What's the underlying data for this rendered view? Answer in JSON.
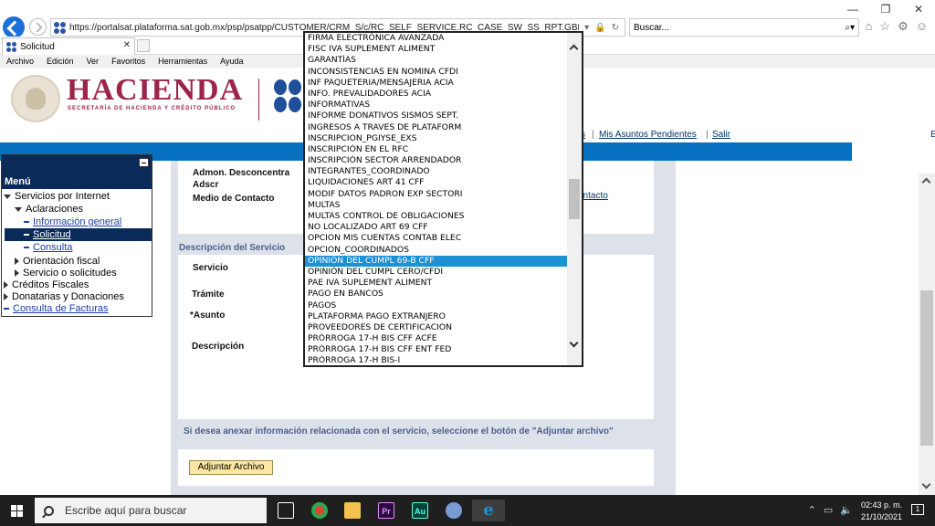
{
  "browser": {
    "url": "https://portalsat.plataforma.sat.gob.mx/psp/psatpp/CUSTOMER/CRM_S/c/RC_SELF_SERVICE.RC_CASE_SW_SS_RPT.GBL?DISP_TMPL_ID=RC_SUPI",
    "search_placeholder": "Buscar...",
    "tab_title": "Solicitud",
    "menu": [
      "Archivo",
      "Edición",
      "Ver",
      "Favoritos",
      "Herramientas",
      "Ayuda"
    ]
  },
  "header": {
    "brand": "HACIENDA",
    "brand_subtitle": "SECRETARÍA DE HACIENDA Y CRÉDITO PÚBLICO",
    "links": {
      "truncated": "s",
      "pending": "Mis Asuntos Pendientes",
      "logout": "Salir",
      "edge": "E"
    }
  },
  "sidebar": {
    "title": "Menú",
    "items": {
      "servicios": "Servicios por Internet",
      "aclaraciones": "Aclaraciones",
      "info_general": "Información general",
      "solicitud": "Solicitud",
      "consulta": "Consulta",
      "orientacion": "Orientación fiscal",
      "servicio_solicitudes": "Servicio o solicitudes",
      "creditos": "Créditos Fiscales",
      "donatarias": "Donatarias y Donaciones",
      "facturas": "Consulta de Facturas"
    }
  },
  "form": {
    "admin_label": "Admon. Desconcentra",
    "adscr_label": "Adscr",
    "medio_label": "Medio de Contacto",
    "medio_link": "ontacto",
    "section_title": "Descripción del Servicio",
    "servicio_label": "Servicio",
    "tramite_label": "Trámite",
    "asunto_label": "*Asunto",
    "descripcion_label": "Descripción",
    "attach_note": "Si desea anexar información relacionada con el servicio, seleccione el botón de \"Adjuntar archivo\"",
    "attach_button": "Adjuntar Archivo"
  },
  "dropdown": {
    "selected": "OPINIÓN DEL CUMPL 69-B CFF",
    "options": [
      "FIRMA ELECTRÓNICA AVANZADA",
      "FISC IVA SUPLEMENT ALIMENT",
      "GARANTÍAS",
      "INCONSISTENCIAS EN NOMINA CFDI",
      "INF PAQUETERIA/MENSAJERIA ACIA",
      "INFO. PREVALIDADORES ACIA",
      "INFORMATIVAS",
      "INFORME DONATIVOS SISMOS SEPT.",
      "INGRESOS A TRAVES DE PLATAFORM",
      "INSCRIPCION_PGIYSE_EXS",
      "INSCRIPCIÓN EN EL RFC",
      "INSCRIPCIÓN SECTOR ARRENDADOR",
      "INTEGRANTES_COORDINADO",
      "LIQUIDACIONES ART 41 CFF",
      "MODIF DATOS PADRON EXP SECTORI",
      "MULTAS",
      "MULTAS CONTROL DE OBLIGACIONES",
      "NO LOCALIZADO ART 69 CFF",
      "OPCION MIS CUENTAS CONTAB ELEC",
      "OPCION_COORDINADOS",
      "OPINIÓN DEL CUMPL 69-B CFF",
      "OPINIÓN DEL CUMPL CERO/CFDI",
      "PAE IVA SUPLEMENT ALIMENT",
      "PAGO EN BANCOS",
      "PAGOS",
      "PLATAFORMA PAGO EXTRANJERO",
      "PROVEEDORES DE CERTIFICACION",
      "PRÓRROGA 17-H BIS CFF ACFE",
      "PRÓRROGA 17-H BIS CFF ENT FED",
      "PRÓRROGA 17-H BIS-I"
    ]
  },
  "taskbar": {
    "search_placeholder": "Escribe aquí para buscar",
    "time": "02:43 p. m.",
    "date": "21/10/2021",
    "notifications": "1",
    "apps": [
      {
        "label": "",
        "color": "#ffffff"
      },
      {
        "label": "",
        "color": "#e0443a"
      },
      {
        "label": "",
        "color": "#f2c14e"
      },
      {
        "label": "Pr",
        "color": "#2a0a3d"
      },
      {
        "label": "Au",
        "color": "#00443d"
      },
      {
        "label": "",
        "color": "#7a9bd1"
      },
      {
        "label": "e",
        "color": "#1e90d4"
      }
    ]
  },
  "colors": {
    "brand": "#9d2449",
    "bluebar": "#0571c0",
    "selection": "#1e90d4",
    "menu_dark": "#0a2a5a"
  }
}
